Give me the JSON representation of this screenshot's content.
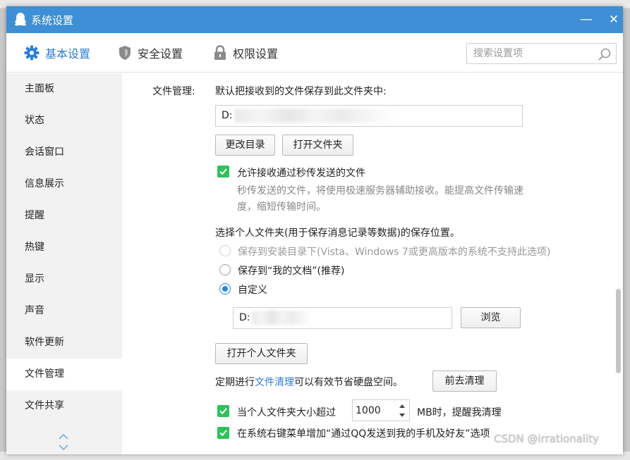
{
  "window": {
    "title": "系统设置",
    "minimize_glyph": "—",
    "close_glyph": "✕"
  },
  "toolbar": {
    "tabs": [
      {
        "label": "基本设置",
        "icon": "gear-icon",
        "active": true
      },
      {
        "label": "安全设置",
        "icon": "shield-icon",
        "active": false
      },
      {
        "label": "权限设置",
        "icon": "lock-icon",
        "active": false
      }
    ],
    "search_placeholder": "搜索设置项"
  },
  "sidebar": {
    "items": [
      {
        "label": "主面板"
      },
      {
        "label": "状态"
      },
      {
        "label": "会话窗口"
      },
      {
        "label": "信息展示"
      },
      {
        "label": "提醒"
      },
      {
        "label": "热键"
      },
      {
        "label": "显示"
      },
      {
        "label": "声音"
      },
      {
        "label": "软件更新"
      },
      {
        "label": "文件管理",
        "active": true
      },
      {
        "label": "文件共享"
      }
    ]
  },
  "content": {
    "section_label": "文件管理:",
    "default_folder_label": "默认把接收到的文件保存到此文件夹中:",
    "default_folder_value": "D:",
    "change_dir_button": "更改目录",
    "open_folder_button": "打开文件夹",
    "allow_instant": {
      "label": "允许接收通过秒传发送的文件",
      "checked": true,
      "desc_line1": "秒传发送的文件，将使用极速服务器辅助接收。能提高文件传输速",
      "desc_line2": "度，缩短传输时间。"
    },
    "personal_folder_label": "选择个人文件夹(用于保存消息记录等数据)的保存位置。",
    "radio_options": [
      {
        "label": "保存到安装目录下(Vista、Windows 7或更高版本的系统不支持此选项)",
        "state": "disabled"
      },
      {
        "label": "保存到“我的文档”(推荐)",
        "state": "unchecked"
      },
      {
        "label": "自定义",
        "state": "checked"
      }
    ],
    "custom_path_value": "D:",
    "browse_button": "浏览",
    "open_personal_folder_button": "打开个人文件夹",
    "cleanup_text_before": "定期进行",
    "cleanup_link": "文件清理",
    "cleanup_text_after": "可以有效节省硬盘空间。",
    "go_cleanup_button": "前去清理",
    "size_limit": {
      "label_before": "当个人文件夹大小超过",
      "value": "1000",
      "label_after": "MB时，提醒我清理",
      "checked": true
    },
    "context_menu": {
      "label": "在系统右键菜单增加“通过QQ发送到我的手机及好友”选项",
      "checked": true
    }
  },
  "watermark": "CSDN @irrationality",
  "colors": {
    "titlebar": "#3e8fd5",
    "accent": "#2b7fd4",
    "checkbox": "#2ec25a",
    "sidebar_bg": "#f2f2f2"
  }
}
